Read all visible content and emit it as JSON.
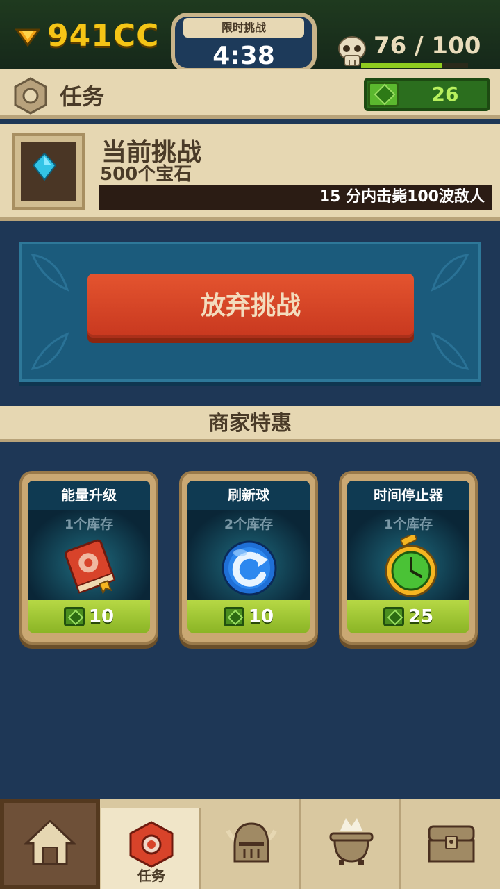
{
  "top": {
    "currency": "941CC",
    "timer_label": "限时挑战",
    "timer": "4:38",
    "lives": "76 / 100",
    "lives_fraction": 0.76
  },
  "task_header": {
    "title": "任务",
    "gems": "26"
  },
  "challenge": {
    "title": "当前挑战",
    "reward": "500个宝石",
    "description": "15 分内击毙100波敌人"
  },
  "abandon_button": "放弃挑战",
  "merchant": {
    "title": "商家特惠",
    "items": [
      {
        "name": "能量升级",
        "stock": "1个库存",
        "price": "10",
        "icon": "red-book-icon"
      },
      {
        "name": "刷新球",
        "stock": "2个库存",
        "price": "10",
        "icon": "refresh-orb-icon"
      },
      {
        "name": "时间停止器",
        "stock": "1个库存",
        "price": "25",
        "icon": "stopwatch-icon"
      }
    ]
  },
  "nav": {
    "items": [
      {
        "icon": "home-icon",
        "label": ""
      },
      {
        "icon": "task-nut-icon",
        "label": "任务"
      },
      {
        "icon": "helmet-icon",
        "label": ""
      },
      {
        "icon": "cauldron-icon",
        "label": ""
      },
      {
        "icon": "chest-icon",
        "label": ""
      }
    ]
  },
  "colors": {
    "currency": "#f5c516",
    "gem_green": "#5bb82e",
    "abandon_red": "#d9472a",
    "background": "#1e3756"
  }
}
